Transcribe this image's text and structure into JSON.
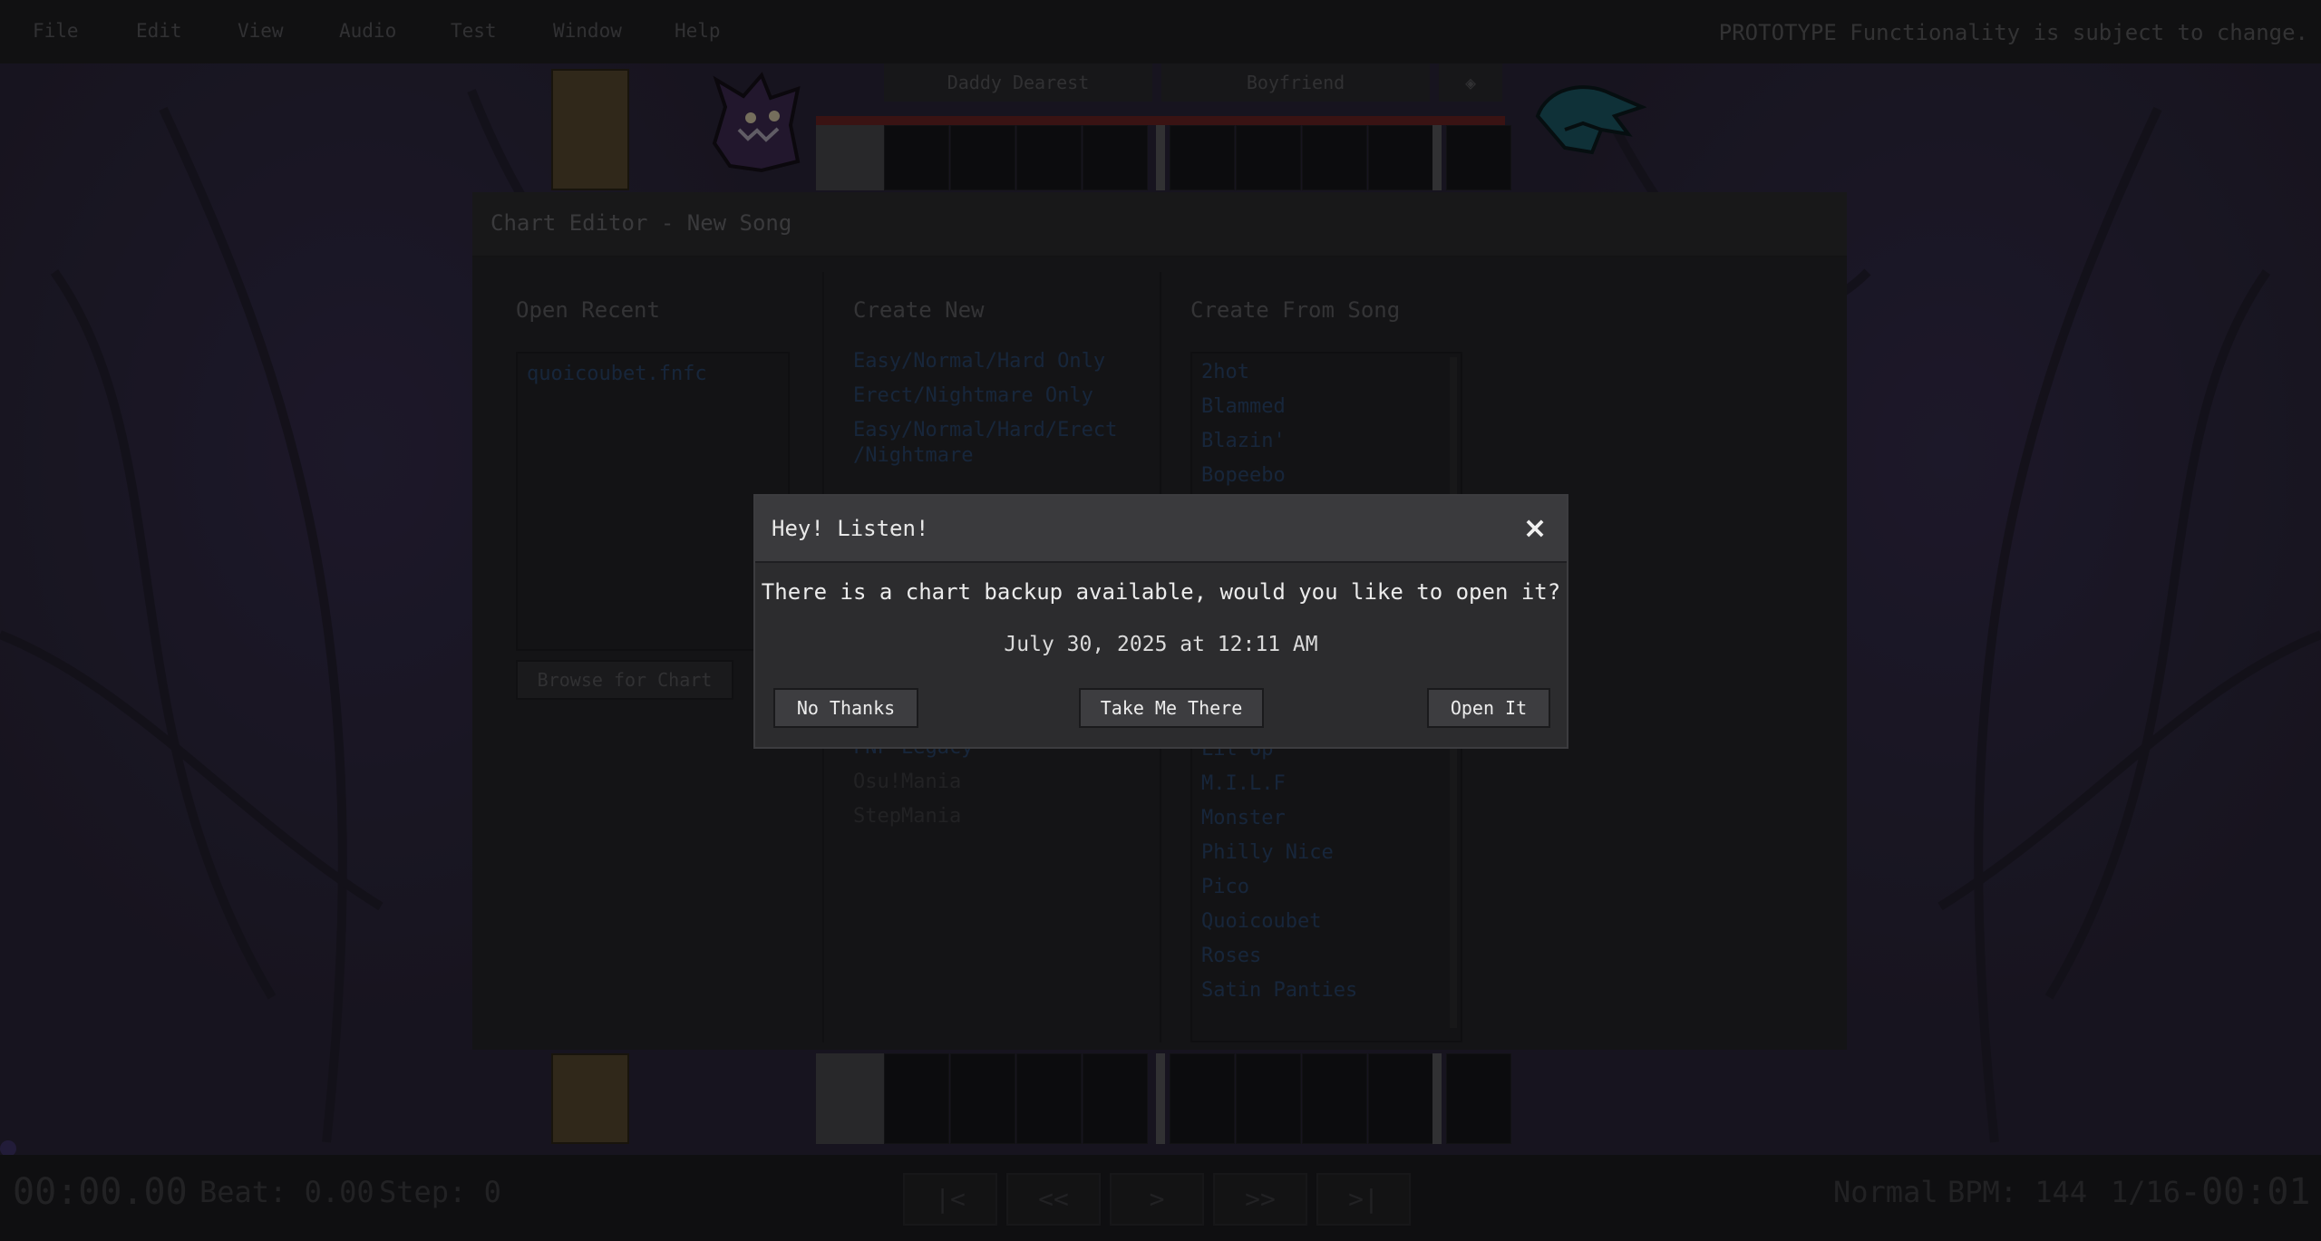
{
  "menubar": {
    "items": [
      "File",
      "Edit",
      "View",
      "Audio",
      "Test",
      "Window",
      "Help"
    ],
    "notice": "PROTOTYPE Functionality is subject to change."
  },
  "strumlines": {
    "opponent": "Daddy Dearest",
    "player": "Boyfriend",
    "toggle_icon": "eye-icon"
  },
  "welcome": {
    "title": "Chart Editor - New Song",
    "open_recent": {
      "heading": "Open Recent",
      "files": [
        "quoicoubet.fnfc"
      ],
      "browse_label": "Browse for Chart"
    },
    "create_new": {
      "heading": "Create New",
      "options": [
        "Easy/Normal/Hard Only",
        "Erect/Nightmare Only",
        "Easy/Normal/Hard/Erect",
        "/Nightmare"
      ],
      "import_partial": "FNF Legacy",
      "import_disabled": [
        "Osu!Mania",
        "StepMania"
      ]
    },
    "create_from_song": {
      "heading": "Create From Song",
      "songs_top": [
        "2hot",
        "Blammed",
        "Blazin'",
        "Bopeebo"
      ],
      "songs_bottom": [
        "Lit Up",
        "M.I.L.F",
        "Monster",
        "Philly Nice",
        "Pico",
        "Quoicoubet",
        "Roses",
        "Satin Panties"
      ]
    }
  },
  "dialog": {
    "title": "Hey! Listen!",
    "message": "There is a chart backup available, would you like to open it?",
    "date": "July 30, 2025 at 12:11 AM",
    "buttons": {
      "no": "No Thanks",
      "take": "Take Me There",
      "open": "Open It"
    },
    "close_icon": "×"
  },
  "playbar": {
    "time": "00:00.00",
    "beat": "Beat: 0.00",
    "step": "Step: 0",
    "controls": [
      "|<",
      "<<",
      ">",
      ">>",
      ">|"
    ],
    "difficulty": "Normal",
    "bpm": "BPM: 144",
    "snap": "1/16",
    "remaining": "-00:01"
  },
  "colors": {
    "accent_link": "#2a466c",
    "dialog_bg": "#2c2c2e",
    "health_bar": "#6a2424"
  }
}
